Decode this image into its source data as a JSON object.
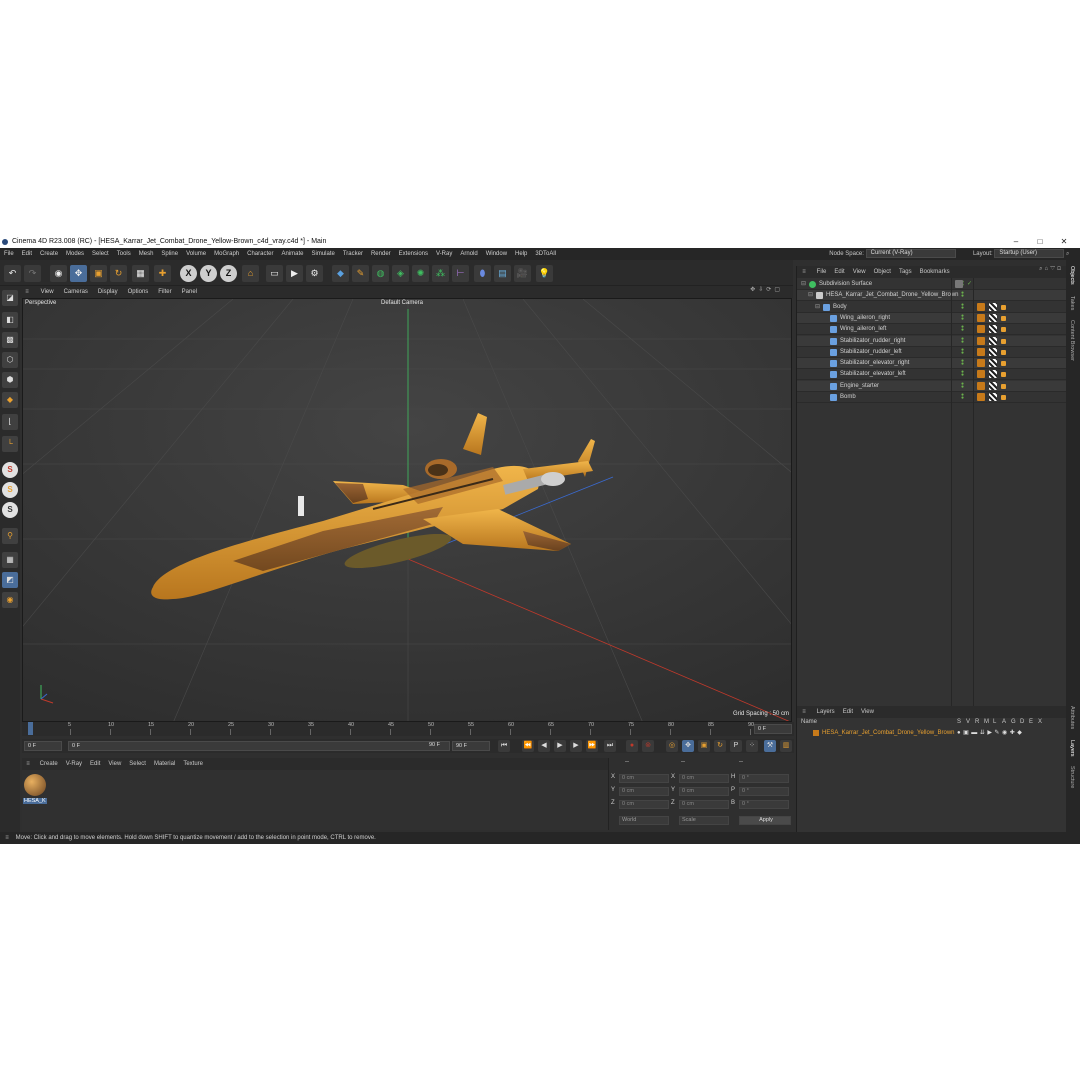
{
  "window": {
    "title": "Cinema 4D R23.008 (RC) - [HESA_Karrar_Jet_Combat_Drone_Yellow-Brown_c4d_vray.c4d *] - Main",
    "minimize": "–",
    "maximize": "□",
    "close": "✕"
  },
  "menu": {
    "items": [
      "File",
      "Edit",
      "Create",
      "Modes",
      "Select",
      "Tools",
      "Mesh",
      "Spline",
      "Volume",
      "MoGraph",
      "Character",
      "Animate",
      "Simulate",
      "Tracker",
      "Render",
      "Extensions",
      "V-Ray",
      "Arnold",
      "Window",
      "Help",
      "3DToAll"
    ],
    "node_space_label": "Node Space:",
    "node_space_value": "Current (V-Ray)",
    "layout_label": "Layout:",
    "layout_value": "Startup (User)"
  },
  "toolbar": {
    "undo": "↶",
    "redo": "↷",
    "axis_x": "X",
    "axis_y": "Y",
    "axis_z": "Z"
  },
  "viewport": {
    "menu": [
      "View",
      "Cameras",
      "Display",
      "Options",
      "Filter",
      "Panel"
    ],
    "label": "Perspective",
    "camera": "Default Camera",
    "grid_spacing": "Grid Spacing : 50 cm",
    "axis_y": "y",
    "axis_z": "z"
  },
  "timeline": {
    "ticks": [
      "0",
      "5",
      "10",
      "15",
      "20",
      "25",
      "30",
      "35",
      "40",
      "45",
      "50",
      "55",
      "60",
      "65",
      "70",
      "75",
      "80",
      "85",
      "90"
    ],
    "current_frame_right": "0 F"
  },
  "frame_controls": {
    "start": "0 F",
    "preview_start": "0 F",
    "preview_end": "90 F",
    "end": "90 F"
  },
  "material_manager": {
    "menu": [
      "Create",
      "V-Ray",
      "Edit",
      "View",
      "Select",
      "Material",
      "Texture"
    ],
    "material_name": "HESA_K"
  },
  "coordinates": {
    "header_left": "--",
    "header_mid": "--",
    "header_right": "--",
    "rows": [
      {
        "a": "X",
        "av": "0 cm",
        "b": "X",
        "bv": "0 cm",
        "c": "H",
        "cv": "0 °"
      },
      {
        "a": "Y",
        "av": "0 cm",
        "b": "Y",
        "bv": "0 cm",
        "c": "P",
        "cv": "0 °"
      },
      {
        "a": "Z",
        "av": "0 cm",
        "b": "Z",
        "bv": "0 cm",
        "c": "B",
        "cv": "0 °"
      }
    ],
    "space": "World",
    "mode": "Scale",
    "apply": "Apply"
  },
  "object_manager": {
    "menu": [
      "File",
      "Edit",
      "View",
      "Object",
      "Tags",
      "Bookmarks"
    ],
    "objects": [
      {
        "name": "Subdivision Surface",
        "depth": 0
      },
      {
        "name": "HESA_Karrar_Jet_Combat_Drone_Yellow_Brown",
        "depth": 1
      },
      {
        "name": "Body",
        "depth": 2
      },
      {
        "name": "Wing_aileron_right",
        "depth": 3
      },
      {
        "name": "Wing_aileron_left",
        "depth": 3
      },
      {
        "name": "Stabilizator_rudder_right",
        "depth": 3
      },
      {
        "name": "Stabilizator_rudder_left",
        "depth": 3
      },
      {
        "name": "Stabilizator_elevator_right",
        "depth": 3
      },
      {
        "name": "Stabilizator_elevator_left",
        "depth": 3
      },
      {
        "name": "Engine_starter",
        "depth": 3
      },
      {
        "name": "Bomb",
        "depth": 3
      }
    ]
  },
  "layer_manager": {
    "menu": [
      "Layers",
      "Edit",
      "View"
    ],
    "name_header": "Name",
    "flags": [
      "S",
      "V",
      "R",
      "M",
      "L",
      "A",
      "G",
      "D",
      "E",
      "X"
    ],
    "layer_name": "HESA_Karrar_Jet_Combat_Drone_Yellow_Brown",
    "layer_color": "#c77a1a"
  },
  "side_tabs": [
    "Objects",
    "Takes",
    "Content Browser",
    "Attributes",
    "Layers",
    "Structure"
  ],
  "status": "Move: Click and drag to move elements. Hold down SHIFT to quantize movement / add to the selection in point mode, CTRL to remove.",
  "colors": {
    "accent": "#4a6d9a",
    "drone_yellow": "#e6a23a",
    "drone_brown": "#8a5a2e"
  }
}
